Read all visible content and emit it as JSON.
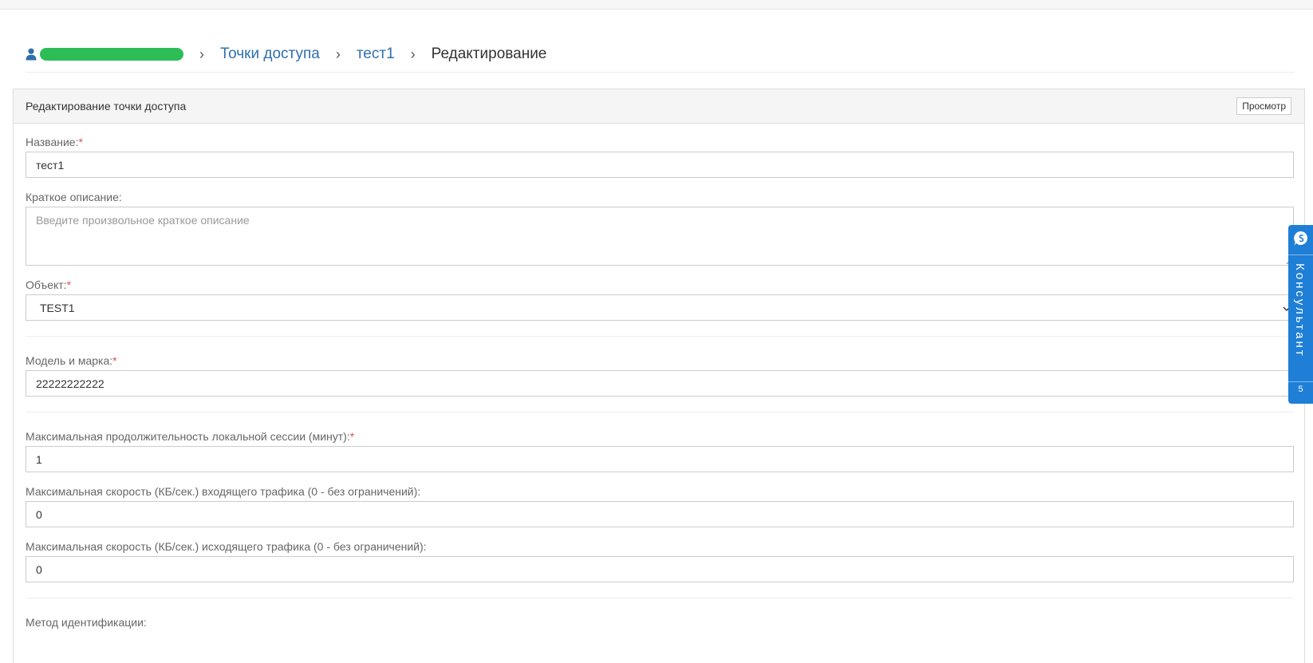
{
  "breadcrumb": {
    "user_name": "••• ••••••• •••",
    "items": [
      "Точки доступа",
      "тест1"
    ],
    "current": "Редактирование"
  },
  "panel": {
    "title": "Редактирование точки доступа",
    "view_button": "Просмотр"
  },
  "form": {
    "name": {
      "label": "Название:",
      "required_mark": "*",
      "value": "тест1"
    },
    "description": {
      "label": "Краткое описание:",
      "placeholder": "Введите произвольное краткое описание",
      "value": ""
    },
    "object": {
      "label": "Объект:",
      "required_mark": "*",
      "selected": "TEST1"
    },
    "model": {
      "label": "Модель и марка:",
      "required_mark": "*",
      "value": "22222222222"
    },
    "max_session": {
      "label": "Максимальная продолжительность локальной сессии (минут):",
      "required_mark": "*",
      "value": "1"
    },
    "max_in_speed": {
      "label": "Максимальная скорость (КБ/сек.) входящего трафика (0 - без ограничений):",
      "value": "0"
    },
    "max_out_speed": {
      "label": "Максимальная скорость (КБ/сек.) исходящего трафика (0 - без ограничений):",
      "value": "0"
    },
    "ident_method": {
      "label": "Метод идентификации:"
    }
  },
  "consultant": {
    "label": "Консультант",
    "count": "5",
    "icon": "chat-bubble-icon"
  },
  "colors": {
    "link": "#2f6fad",
    "required": "#d9534f",
    "consultant_bg": "#1f7fd6",
    "user_highlight": "#2dbd57"
  }
}
